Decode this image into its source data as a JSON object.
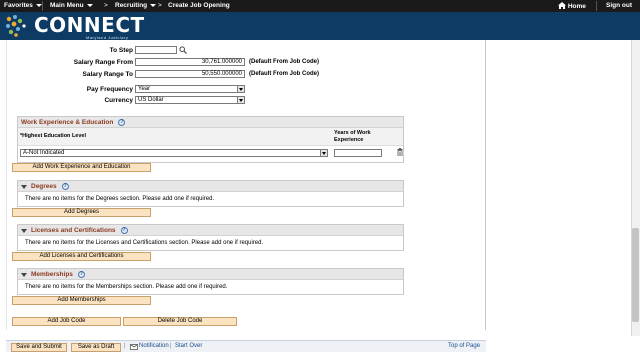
{
  "topbar": {
    "favorites": "Favorites",
    "main_menu": "Main Menu",
    "recruiting": "Recruiting",
    "breadcrumb_current": "Create Job Opening",
    "home": "Home",
    "sign_out": "Sign out"
  },
  "header": {
    "logo_text": "CONNECT",
    "logo_subtext": "Maryland Judiciary"
  },
  "form": {
    "to_step_label": "To Step",
    "to_step_value": "",
    "salary_from_label": "Salary Range From",
    "salary_from_value": "30,761.000000",
    "salary_from_note": "(Default From Job Code)",
    "salary_to_label": "Salary Range To",
    "salary_to_value": "50,550.000000",
    "salary_to_note": "(Default From Job Code)",
    "pay_frequency_label": "Pay Frequency",
    "pay_frequency_value": "Year",
    "currency_label": "Currency",
    "currency_value": "US Dollar"
  },
  "work_experience": {
    "title": "Work Experience & Education",
    "col_education": "*Highest Education Level",
    "col_years_line1": "Years of Work",
    "col_years_line2": "Experience",
    "education_value": "A-Not Indicated",
    "years_value": "",
    "add_button": "Add Work Experience and Education"
  },
  "degrees": {
    "title": "Degrees",
    "empty_text": "There are no items for the Degrees section.  Please add one if required.",
    "add_button": "Add Degrees"
  },
  "licenses": {
    "title": "Licenses and Certifications",
    "empty_text": "There are no items for the Licenses and Certifications section.  Please add one if required.",
    "add_button": "Add Licenses and Certifications"
  },
  "memberships": {
    "title": "Memberships",
    "empty_text": "There are no items for the Memberships section.  Please add one if required.",
    "add_button": "Add Memberships"
  },
  "actions": {
    "add_job_code": "Add Job Code",
    "delete_job_code": "Delete Job Code"
  },
  "bottombar": {
    "save_submit": "Save and Submit",
    "save_draft": "Save as Draft",
    "notification": "Notification",
    "separator": "|",
    "start_over": "Start Over",
    "top_of_page": "Top of Page"
  },
  "icons": {
    "search": "search-icon",
    "help": "help-icon",
    "trash": "trash-icon",
    "home": "home-icon",
    "notification": "notification-icon"
  },
  "colors": {
    "header_bg": "#0d3b63",
    "section_title": "#8b3a1f",
    "button_bg": "#fbe3c1",
    "link": "#1a4d8c"
  }
}
